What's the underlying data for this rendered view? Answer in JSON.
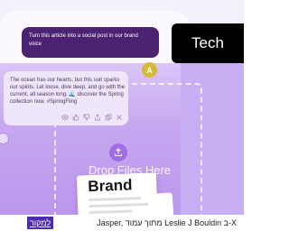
{
  "chat": {
    "prompt": "Turn this article into a social post in our brand voice",
    "avatar_initial": "A",
    "response": "The ocean has our hearts, but this suit sparks our spirits. Let loose, dive deep, and go with the current, all season long. 🌊 discover the Spring collection now. #SpringFling"
  },
  "dropzone": {
    "label": "Drop Files Here"
  },
  "brand_card": {
    "title": "Brand"
  },
  "badge": {
    "label": "Tech"
  },
  "caption": {
    "credit": "Jasper, מתוך עמוד Leslie J Bouldin ב-X",
    "source_link": "למקור"
  },
  "colors": {
    "accent": "#4b2370",
    "purple": "#c6a6f0",
    "badge_bg": "#000000",
    "source_bg": "#4d2bb0"
  },
  "icons": [
    "upload-icon",
    "eye-icon",
    "thumbs-up-icon",
    "thumbs-down-icon",
    "share-icon",
    "copy-icon",
    "close-icon"
  ]
}
